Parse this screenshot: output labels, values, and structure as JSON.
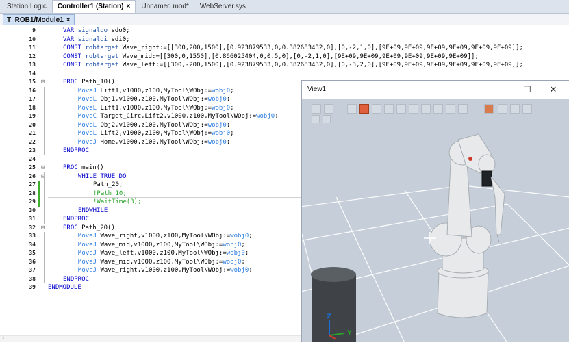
{
  "tabs": [
    {
      "label": "Station Logic",
      "active": false,
      "closable": false
    },
    {
      "label": "Controller1 (Station)",
      "active": true,
      "closable": true
    },
    {
      "label": "Unnamed.mod*",
      "active": false,
      "closable": false
    },
    {
      "label": "WebServer.sys",
      "active": false,
      "closable": false
    }
  ],
  "module_tab": {
    "label": "T_ROB1/Module1",
    "close": "×"
  },
  "close_glyph": "×",
  "code_lines": [
    {
      "n": "9",
      "fold": "",
      "segs": [
        [
          "kw",
          "VAR"
        ],
        [
          "",
          " "
        ],
        [
          "kw2",
          "signaldo"
        ],
        [
          "",
          " sdo0;"
        ]
      ],
      "indent": 1
    },
    {
      "n": "10",
      "fold": "",
      "segs": [
        [
          "kw",
          "VAR"
        ],
        [
          "",
          " "
        ],
        [
          "kw2",
          "signaldi"
        ],
        [
          "",
          " sdi0;"
        ]
      ],
      "indent": 1
    },
    {
      "n": "11",
      "fold": "",
      "segs": [
        [
          "kw",
          "CONST"
        ],
        [
          "",
          " "
        ],
        [
          "kw2",
          "robtarget"
        ],
        [
          "",
          " Wave_right:=[[300,200,1500],[0.923879533,0,0.382683432,0],[0,-2,1,0],[9E+09,9E+09,9E+09,9E+09,9E+09,9E+09]];"
        ]
      ],
      "indent": 1
    },
    {
      "n": "12",
      "fold": "",
      "segs": [
        [
          "kw",
          "CONST"
        ],
        [
          "",
          " "
        ],
        [
          "kw2",
          "robtarget"
        ],
        [
          "",
          " Wave_mid:=[[300,0,1550],[0.866025404,0,0.5,0],[0,-2,1,0],[9E+09,9E+09,9E+09,9E+09,9E+09,9E+09]];"
        ]
      ],
      "indent": 1
    },
    {
      "n": "13",
      "fold": "",
      "segs": [
        [
          "kw",
          "CONST"
        ],
        [
          "",
          " "
        ],
        [
          "kw2",
          "robtarget"
        ],
        [
          "",
          " Wave_left:=[[300,-200,1500],[0.923879533,0,0.382683432,0],[0,-3,2,0],[9E+09,9E+09,9E+09,9E+09,9E+09,9E+09]];"
        ]
      ],
      "indent": 1
    },
    {
      "n": "14",
      "fold": "",
      "segs": [],
      "indent": 0
    },
    {
      "n": "15",
      "fold": "⊟",
      "segs": [
        [
          "kw",
          "PROC"
        ],
        [
          "",
          " Path_10()"
        ]
      ],
      "indent": 1
    },
    {
      "n": "16",
      "fold": "",
      "segs": [
        [
          "mv",
          "MoveJ"
        ],
        [
          "",
          " Lift1,v1000,z100,MyTool\\WObj:="
        ],
        [
          "wo",
          "wobj0"
        ],
        [
          "",
          ";"
        ]
      ],
      "indent": 2
    },
    {
      "n": "17",
      "fold": "",
      "segs": [
        [
          "mv",
          "MoveL"
        ],
        [
          "",
          " Obj1,v1000,z100,MyTool\\WObj:="
        ],
        [
          "wo",
          "wobj0"
        ],
        [
          "",
          ";"
        ]
      ],
      "indent": 2
    },
    {
      "n": "18",
      "fold": "",
      "segs": [
        [
          "mv",
          "MoveL"
        ],
        [
          "",
          " Lift1,v1000,z100,MyTool\\WObj:="
        ],
        [
          "wo",
          "wobj0"
        ],
        [
          "",
          ";"
        ]
      ],
      "indent": 2
    },
    {
      "n": "19",
      "fold": "",
      "segs": [
        [
          "mv",
          "MoveC"
        ],
        [
          "",
          " Target_Circ,Lift2,v1000,z100,MyTool\\WObj:="
        ],
        [
          "wo",
          "wobj0"
        ],
        [
          "",
          ";"
        ]
      ],
      "indent": 2
    },
    {
      "n": "20",
      "fold": "",
      "segs": [
        [
          "mv",
          "MoveL"
        ],
        [
          "",
          " Obj2,v1000,z100,MyTool\\WObj:="
        ],
        [
          "wo",
          "wobj0"
        ],
        [
          "",
          ";"
        ]
      ],
      "indent": 2
    },
    {
      "n": "21",
      "fold": "",
      "segs": [
        [
          "mv",
          "MoveL"
        ],
        [
          "",
          " Lift2,v1000,z100,MyTool\\WObj:="
        ],
        [
          "wo",
          "wobj0"
        ],
        [
          "",
          ";"
        ]
      ],
      "indent": 2
    },
    {
      "n": "22",
      "fold": "",
      "segs": [
        [
          "mv",
          "MoveJ"
        ],
        [
          "",
          " Home,v1000,z100,MyTool\\WObj:="
        ],
        [
          "wo",
          "wobj0"
        ],
        [
          "",
          ";"
        ]
      ],
      "indent": 2
    },
    {
      "n": "23",
      "fold": "",
      "segs": [
        [
          "kw",
          "ENDPROC"
        ]
      ],
      "indent": 1
    },
    {
      "n": "24",
      "fold": "",
      "segs": [],
      "indent": 0
    },
    {
      "n": "25",
      "fold": "⊟",
      "segs": [
        [
          "kw",
          "PROC"
        ],
        [
          "",
          " main()"
        ]
      ],
      "indent": 1
    },
    {
      "n": "26",
      "fold": "⊟",
      "segs": [
        [
          "kw",
          "WHILE"
        ],
        [
          "",
          " "
        ],
        [
          "kw",
          "TRUE"
        ],
        [
          "",
          " "
        ],
        [
          "kw",
          "DO"
        ]
      ],
      "indent": 2
    },
    {
      "n": "27",
      "fold": "",
      "segs": [
        [
          "",
          "Path_20;"
        ]
      ],
      "indent": 3
    },
    {
      "n": "28",
      "fold": "",
      "segs": [
        [
          "cm",
          "!Path_10;"
        ]
      ],
      "indent": 3
    },
    {
      "n": "29",
      "fold": "",
      "segs": [
        [
          "cm",
          "!WaitTime(3);"
        ]
      ],
      "indent": 3
    },
    {
      "n": "30",
      "fold": "",
      "segs": [
        [
          "kw",
          "ENDWHILE"
        ]
      ],
      "indent": 2
    },
    {
      "n": "31",
      "fold": "",
      "segs": [
        [
          "kw",
          "ENDPROC"
        ]
      ],
      "indent": 1
    },
    {
      "n": "32",
      "fold": "⊟",
      "segs": [
        [
          "kw",
          "PROC"
        ],
        [
          "",
          " Path_20()"
        ]
      ],
      "indent": 1
    },
    {
      "n": "33",
      "fold": "",
      "segs": [
        [
          "mv",
          "MoveJ"
        ],
        [
          "",
          " Wave_right,v1000,z100,MyTool\\WObj:="
        ],
        [
          "wo",
          "wobj0"
        ],
        [
          "",
          ";"
        ]
      ],
      "indent": 2
    },
    {
      "n": "34",
      "fold": "",
      "segs": [
        [
          "mv",
          "MoveJ"
        ],
        [
          "",
          " Wave_mid,v1000,z100,MyTool\\WObj:="
        ],
        [
          "wo",
          "wobj0"
        ],
        [
          "",
          ";"
        ]
      ],
      "indent": 2
    },
    {
      "n": "35",
      "fold": "",
      "segs": [
        [
          "mv",
          "MoveJ"
        ],
        [
          "",
          " Wave_left,v1000,z100,MyTool\\WObj:="
        ],
        [
          "wo",
          "wobj0"
        ],
        [
          "",
          ";"
        ]
      ],
      "indent": 2
    },
    {
      "n": "36",
      "fold": "",
      "segs": [
        [
          "mv",
          "MoveJ"
        ],
        [
          "",
          " Wave_mid,v1000,z100,MyTool\\WObj:="
        ],
        [
          "wo",
          "wobj0"
        ],
        [
          "",
          ";"
        ]
      ],
      "indent": 2
    },
    {
      "n": "37",
      "fold": "",
      "segs": [
        [
          "mv",
          "MoveJ"
        ],
        [
          "",
          " Wave_right,v1000,z100,MyTool\\WObj:="
        ],
        [
          "wo",
          "wobj0"
        ],
        [
          "",
          ";"
        ]
      ],
      "indent": 2
    },
    {
      "n": "38",
      "fold": "",
      "segs": [
        [
          "kw",
          "ENDPROC"
        ]
      ],
      "indent": 1
    },
    {
      "n": "39",
      "fold": "",
      "segs": [
        [
          "kw",
          "ENDMODULE"
        ]
      ],
      "indent": 0
    }
  ],
  "view": {
    "title": "View1",
    "minimize": "—",
    "maximize": "☐",
    "close": "✕",
    "axis_z": "Z",
    "axis_y": "Y"
  },
  "colors": {
    "keyword": "#0000cc",
    "type": "#1a50a8",
    "move_instruction": "#2b7de0",
    "comment": "#2aa32a",
    "scene_bg": "#c6cfd9",
    "robot": "#e6e8ea"
  }
}
